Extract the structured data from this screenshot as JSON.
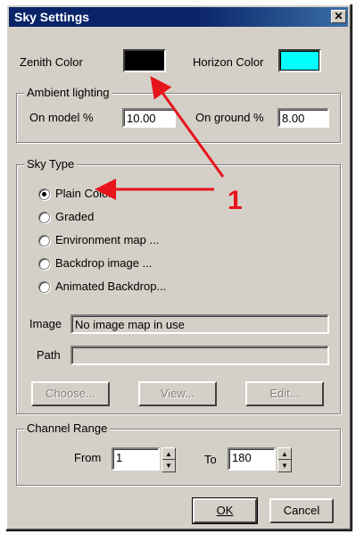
{
  "dialog": {
    "title": "Sky Settings",
    "close_glyph": "✕"
  },
  "colors": {
    "zenith_label": "Zenith Color",
    "zenith_value": "#000000",
    "horizon_label": "Horizon Color",
    "horizon_value": "#00ffff"
  },
  "ambient": {
    "title": "Ambient lighting",
    "model_label": "On model %",
    "model_value": "10.00",
    "ground_label": "On ground %",
    "ground_value": "8.00"
  },
  "sky_type": {
    "title": "Sky Type",
    "options": [
      {
        "label": "Plain Color",
        "selected": true
      },
      {
        "label": "Graded",
        "selected": false
      },
      {
        "label": "Environment map ...",
        "selected": false
      },
      {
        "label": "Backdrop image ...",
        "selected": false
      },
      {
        "label": "Animated Backdrop...",
        "selected": false
      }
    ],
    "image_label": "Image",
    "image_value": "No image map in use",
    "path_label": "Path",
    "path_value": "",
    "choose_label": "Choose...",
    "view_label": "View...",
    "edit_label": "Edit..."
  },
  "channel_range": {
    "title": "Channel Range",
    "from_label": "From",
    "from_value": "1",
    "to_label": "To",
    "to_value": "180"
  },
  "footer": {
    "ok_label": "OK",
    "cancel_label": "Cancel"
  },
  "annotation": {
    "label": "1",
    "color": "#e8141c"
  }
}
